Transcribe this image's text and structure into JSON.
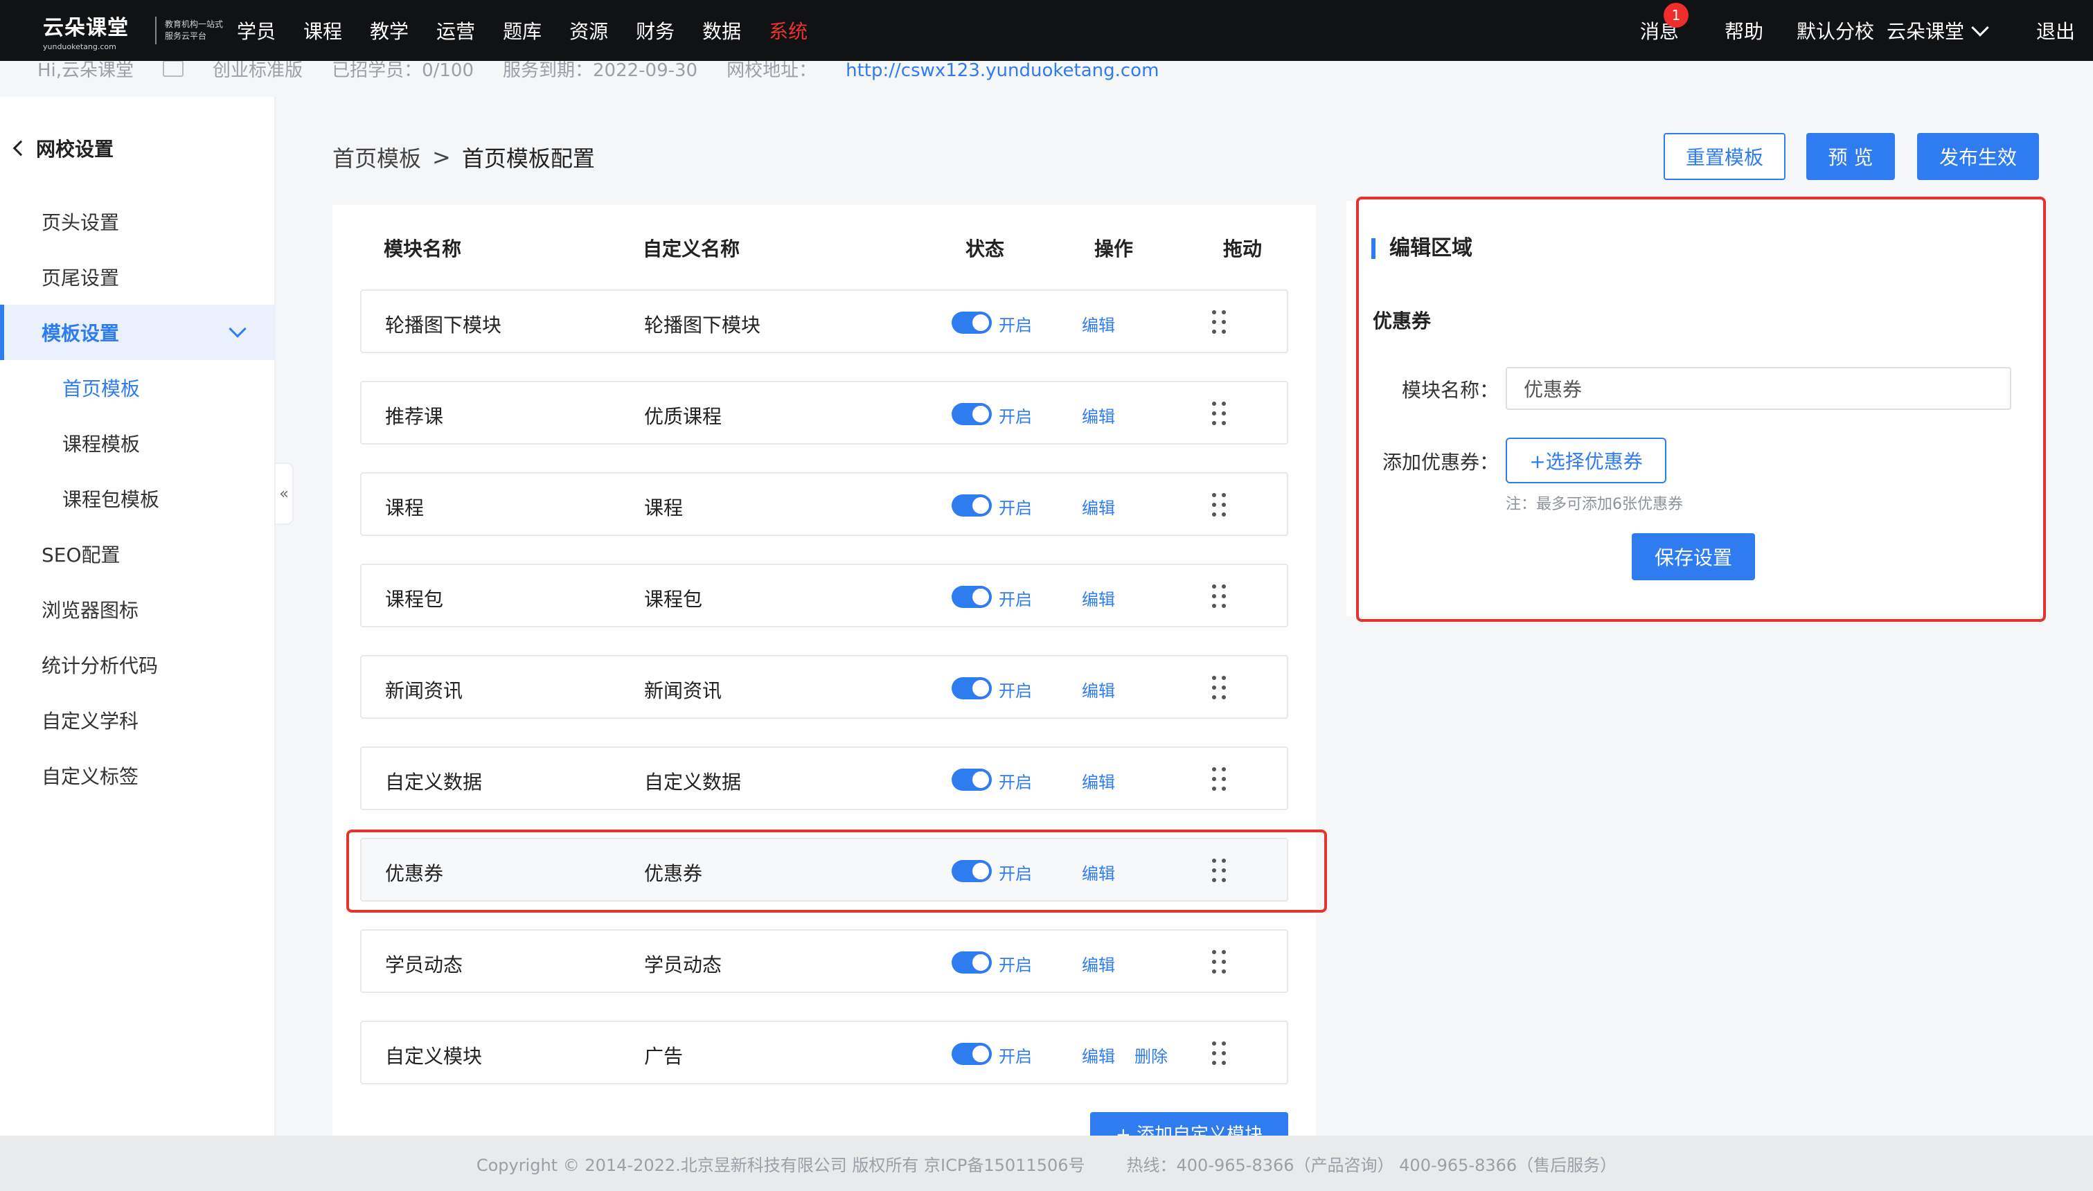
{
  "topnav": {
    "logo_cn": "云朵课堂",
    "logo_en": "yunduoketang.com",
    "logo_tag": "教育机构一站式服务云平台",
    "menu": [
      "学员",
      "课程",
      "教学",
      "运营",
      "题库",
      "资源",
      "财务",
      "数据",
      "系统"
    ],
    "active_menu": "系统",
    "messages_label": "消息",
    "messages_badge": "1",
    "help_label": "帮助",
    "branch_label": "默认分校",
    "school_label": "云朵课堂",
    "logout_label": "退出"
  },
  "infobar": {
    "greeting": "Hi,云朵课堂",
    "edition": "创业标准版",
    "students": "已招学员：0/100",
    "expiry": "服务到期：2022-09-30",
    "site_label": "网校地址：",
    "site_url": "http://cswx123.yunduoketang.com"
  },
  "sidebar": {
    "back_label": "网校设置",
    "items": [
      {
        "label": "页头设置"
      },
      {
        "label": "页尾设置"
      },
      {
        "label": "模板设置"
      },
      {
        "label": "首页模板"
      },
      {
        "label": "课程模板"
      },
      {
        "label": "课程包模板"
      },
      {
        "label": "SEO配置"
      },
      {
        "label": "浏览器图标"
      },
      {
        "label": "统计分析代码"
      },
      {
        "label": "自定义学科"
      },
      {
        "label": "自定义标签"
      }
    ],
    "collapse_glyph": "«"
  },
  "breadcrumb": {
    "parent": "首页模板",
    "separator": ">",
    "current": "首页模板配置"
  },
  "actions": {
    "reset": "重置模板",
    "preview": "预 览",
    "publish": "发布生效"
  },
  "table": {
    "headers": {
      "name": "模块名称",
      "custom": "自定义名称",
      "status": "状态",
      "ops": "操作",
      "drag": "拖动"
    },
    "rows": [
      {
        "name": "轮播图下模块",
        "custom": "轮播图下模块",
        "status": "开启",
        "edit": "编辑"
      },
      {
        "name": "推荐课",
        "custom": "优质课程",
        "status": "开启",
        "edit": "编辑"
      },
      {
        "name": "课程",
        "custom": "课程",
        "status": "开启",
        "edit": "编辑"
      },
      {
        "name": "课程包",
        "custom": "课程包",
        "status": "开启",
        "edit": "编辑"
      },
      {
        "name": "新闻资讯",
        "custom": "新闻资讯",
        "status": "开启",
        "edit": "编辑"
      },
      {
        "name": "自定义数据",
        "custom": "自定义数据",
        "status": "开启",
        "edit": "编辑"
      },
      {
        "name": "优惠券",
        "custom": "优惠券",
        "status": "开启",
        "edit": "编辑"
      },
      {
        "name": "学员动态",
        "custom": "学员动态",
        "status": "开启",
        "edit": "编辑"
      },
      {
        "name": "自定义模块",
        "custom": "广告",
        "status": "开启",
        "edit": "编辑",
        "delete": "删除"
      }
    ],
    "add_button": "+ 添加自定义模块"
  },
  "edit_panel": {
    "title": "编辑区域",
    "section": "优惠券",
    "name_label": "模块名称：",
    "name_value": "优惠券",
    "coupon_label": "添加优惠券：",
    "select_button": "+选择优惠券",
    "hint": "注：最多可添加6张优惠券",
    "save_button": "保存设置"
  },
  "footer": {
    "copyright": "Copyright © 2014-2022.北京昱新科技有限公司 版权所有 京ICP备15011506号",
    "hotline": "热线：400-965-8366（产品咨询） 400-965-8366（售后服务）"
  },
  "colors": {
    "primary": "#2f7cf0",
    "highlight": "#e5342f",
    "nav_bg": "#111214"
  }
}
